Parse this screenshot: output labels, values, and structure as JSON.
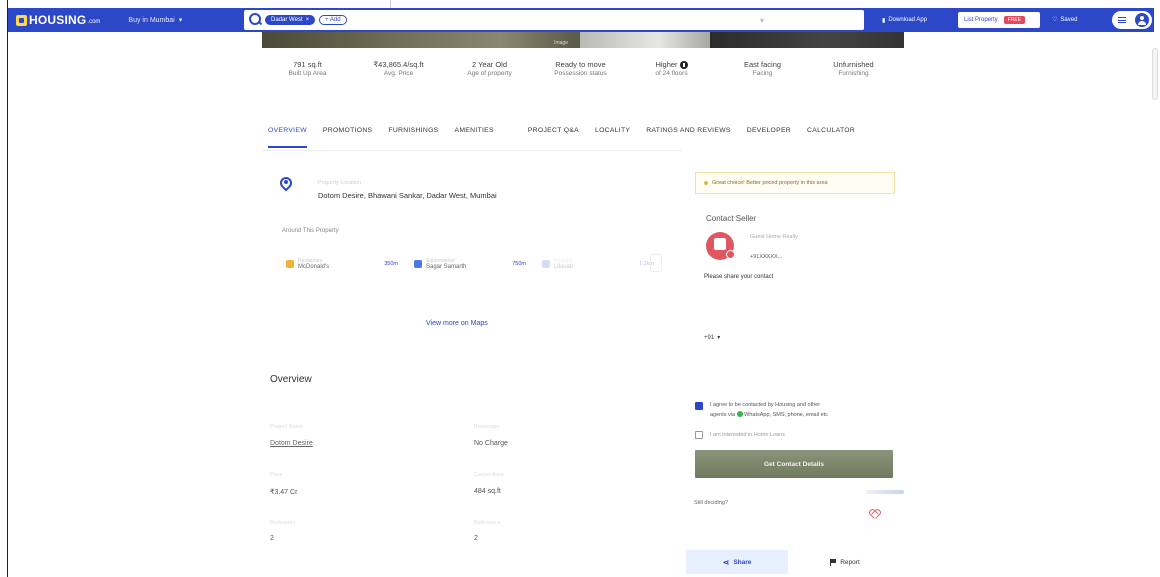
{
  "header": {
    "logo_text": "HOUSING",
    "logo_sub": ".com",
    "city": "Buy in Mumbai",
    "search_chip": "Dadar West",
    "search_add": "+ Add",
    "download_app": "Download App",
    "list_property": "List Property",
    "free_badge": "FREE",
    "saved": "Saved"
  },
  "photos": {
    "label": "Image"
  },
  "stats": [
    {
      "value": "791 sq.ft",
      "label": "Built Up Area"
    },
    {
      "value": "₹43,865.4/sq.ft",
      "label": "Avg. Price"
    },
    {
      "value": "2 Year Old",
      "label": "Age of property"
    },
    {
      "value": "Ready to move",
      "label": "Possession status"
    },
    {
      "value": "Higher",
      "label": "of 24 floors"
    },
    {
      "value": "East facing",
      "label": "Facing"
    },
    {
      "value": "Unfurnished",
      "label": "Furnishing"
    }
  ],
  "tabs": [
    "OVERVIEW",
    "PROMOTIONS",
    "FURNISHINGS",
    "AMENITIES",
    "PROJECT Q&A",
    "LOCALITY",
    "RATINGS AND REVIEWS",
    "DEVELOPER",
    "CALCULATOR"
  ],
  "address": {
    "faint": "Property Location",
    "text": "Dotom Desire, Bhawani Sankar, Dadar West, Mumbai"
  },
  "around": {
    "title": "Around This Property",
    "pois": [
      {
        "sub": "Restaurant",
        "name": "McDonald's",
        "dist": "350m"
      },
      {
        "sub": "Supermarket",
        "name": "Sagar Samarth",
        "dist": "750m"
      },
      {
        "sub": "Hospital",
        "name": "Lilavati",
        "dist": "1.2km"
      }
    ],
    "view_maps": "View more on Maps"
  },
  "overview": {
    "title": "Overview",
    "items": [
      {
        "label": "Project Name",
        "value": "Dotom Desire"
      },
      {
        "label": "Brokerage",
        "value": "No Charge"
      },
      {
        "label": "Price",
        "value": "₹3.47 Cr"
      },
      {
        "label": "Carpet Area",
        "value": "484 sq.ft"
      },
      {
        "label": "Bedrooms",
        "value": "2"
      },
      {
        "label": "Bathrooms",
        "value": "2"
      }
    ]
  },
  "right": {
    "notice": "Great choice! Better priced property in this area",
    "contact_title": "Contact Seller",
    "seller_name": "Guest Home Realty",
    "seller_phone": "+91XXXXX...",
    "share_contact": "Please share your contact",
    "country_code": "+91",
    "consent_line1": "I agree to be contacted by Housing and other",
    "consent_line2": "agents via",
    "consent_line2b": "WhatsApp, SMS, phone, email etc",
    "loan_text": "I am interested in Home Loans",
    "cta": "Get Contact Details",
    "still_deciding": "Still deciding?",
    "share": "Share",
    "report": "Report"
  },
  "colors": {
    "brand": "#2c48c9",
    "accent_red": "#e05762"
  }
}
